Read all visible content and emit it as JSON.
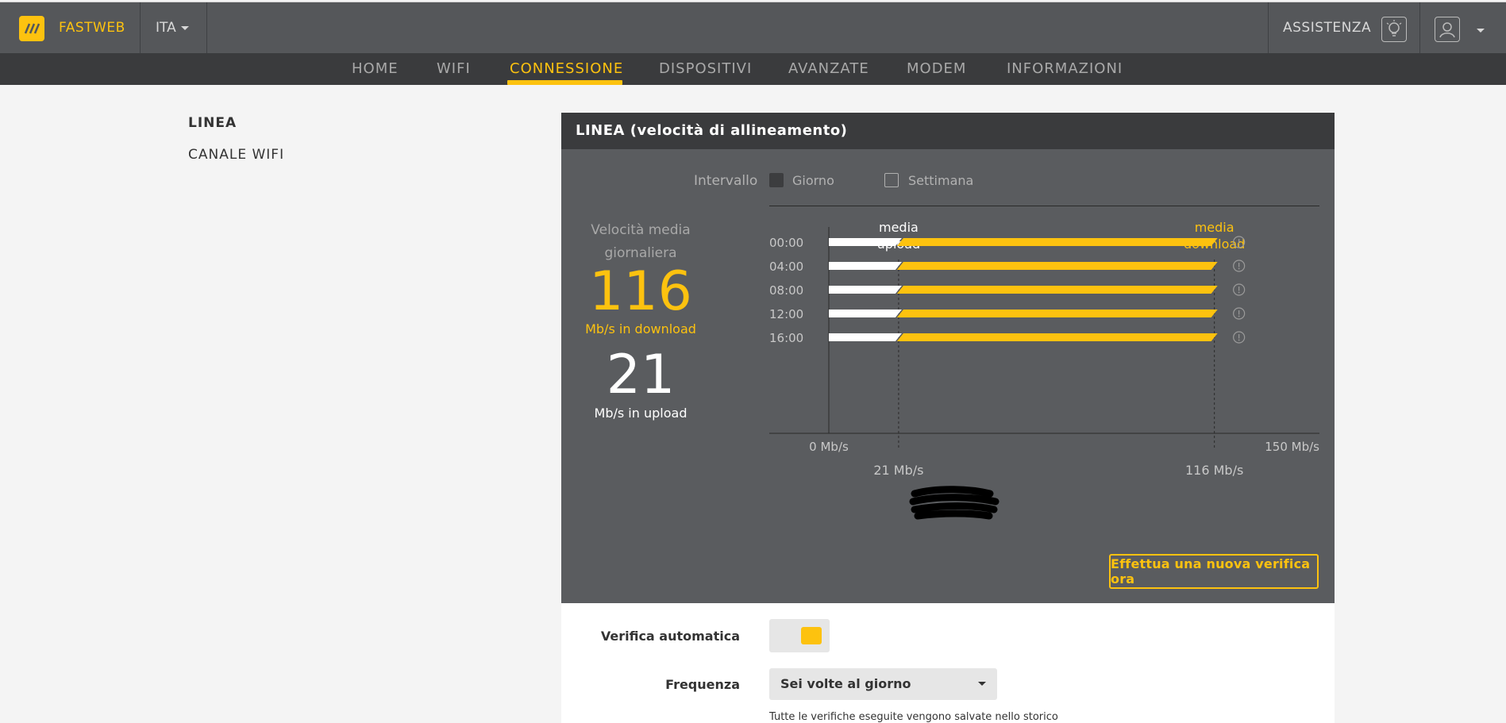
{
  "header": {
    "brand": "FASTWEB",
    "language": "ITA",
    "assist_label": "ASSISTENZA"
  },
  "nav": {
    "items": [
      {
        "label": "HOME"
      },
      {
        "label": "WIFI"
      },
      {
        "label": "CONNESSIONE"
      },
      {
        "label": "DISPOSITIVI"
      },
      {
        "label": "AVANZATE"
      },
      {
        "label": "MODEM"
      },
      {
        "label": "INFORMAZIONI"
      }
    ],
    "active": "CONNESSIONE"
  },
  "sidebar": {
    "items": [
      {
        "label": "LINEA"
      },
      {
        "label": "CANALE WIFI"
      }
    ],
    "active": "LINEA"
  },
  "panel": {
    "title": "LINEA (velocità di allineamento)",
    "interval_label": "Intervallo",
    "options": [
      {
        "label": "Giorno",
        "checked": true
      },
      {
        "label": "Settimana",
        "checked": false
      }
    ],
    "avg_label_line1": "Velocità media",
    "avg_label_line2": "giornaliera",
    "download_value": "116",
    "download_unit": "Mb/s in download",
    "upload_value": "21",
    "upload_unit": "Mb/s in upload",
    "verify_button": "Effettua una nuova verifica ora"
  },
  "chart_data": {
    "type": "bar",
    "categories": [
      "00:00",
      "04:00",
      "08:00",
      "12:00",
      "16:00"
    ],
    "series": [
      {
        "name": "media upload",
        "values": [
          21,
          21,
          21,
          21,
          21
        ]
      },
      {
        "name": "media download",
        "values": [
          116,
          116,
          116,
          116,
          116
        ]
      }
    ],
    "xlim": [
      0,
      150
    ],
    "axis_min_label": "0 Mb/s",
    "axis_max_label": "150 Mb/s",
    "upload_avg_label": "21 Mb/s",
    "download_avg_label": "116 Mb/s",
    "legend_upload_line1": "media",
    "legend_upload_line2": "upload",
    "legend_download_line1": "media",
    "legend_download_line2": "download",
    "colors": {
      "upload": "#ffffff",
      "download": "#fdc20f"
    }
  },
  "settings": {
    "auto_verify_label": "Verifica automatica",
    "auto_verify_on": true,
    "frequency_label": "Frequenza",
    "frequency_value": "Sei volte al giorno",
    "note": "Tutte le verifiche eseguite vengono salvate nello storico"
  }
}
